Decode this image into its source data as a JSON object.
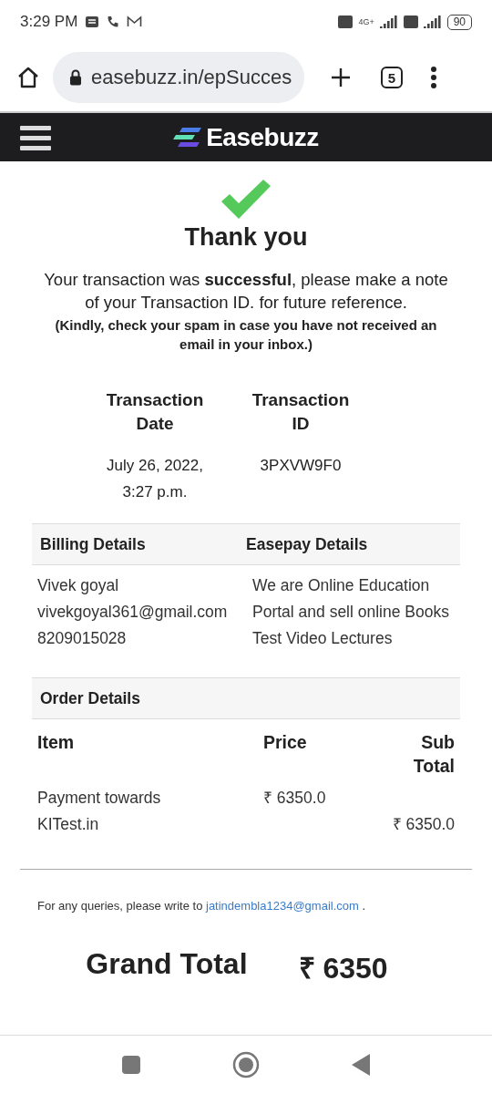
{
  "status_bar": {
    "time": "3:29 PM",
    "network": "4G+",
    "battery": "90"
  },
  "browser": {
    "url": "easebuzz.in/epSucces",
    "tab_count": "5"
  },
  "header": {
    "logo": "Easebuzz"
  },
  "title": "Thank you",
  "message": "Your transaction was **successful**, please make a note of your Transaction ID. for future reference.",
  "note": "(Kindly, check your spam in case you have not received an email in your inbox.)",
  "transaction": [
    {
      "label": "Transaction Date",
      "value": "July 26, 2022, 3:27 p.m."
    },
    {
      "label": "Transaction ID",
      "value": "3PXVW9F0"
    }
  ],
  "billing": {
    "heading": "Billing Details",
    "lines": [
      "Vivek goyal",
      "vivekgoyal361@gmail.com",
      "8209015028"
    ]
  },
  "easepay": {
    "heading": "Easepay Details",
    "text": "We are Online Education Portal and sell online Books Test Video Lectures"
  },
  "order": {
    "heading": "Order Details",
    "columns": [
      "Item",
      "Price",
      "Sub Total"
    ],
    "rows": [
      {
        "item": "Payment towards KITest.in",
        "price": "₹ 6350.0",
        "subtotal": "₹ 6350.0"
      }
    ]
  },
  "query": {
    "text": "For any queries, please write to",
    "email": "jatindembla1234@gmail.com",
    "end": "."
  },
  "grand_total": {
    "label": "Grand Total",
    "value": "₹ 6350"
  }
}
